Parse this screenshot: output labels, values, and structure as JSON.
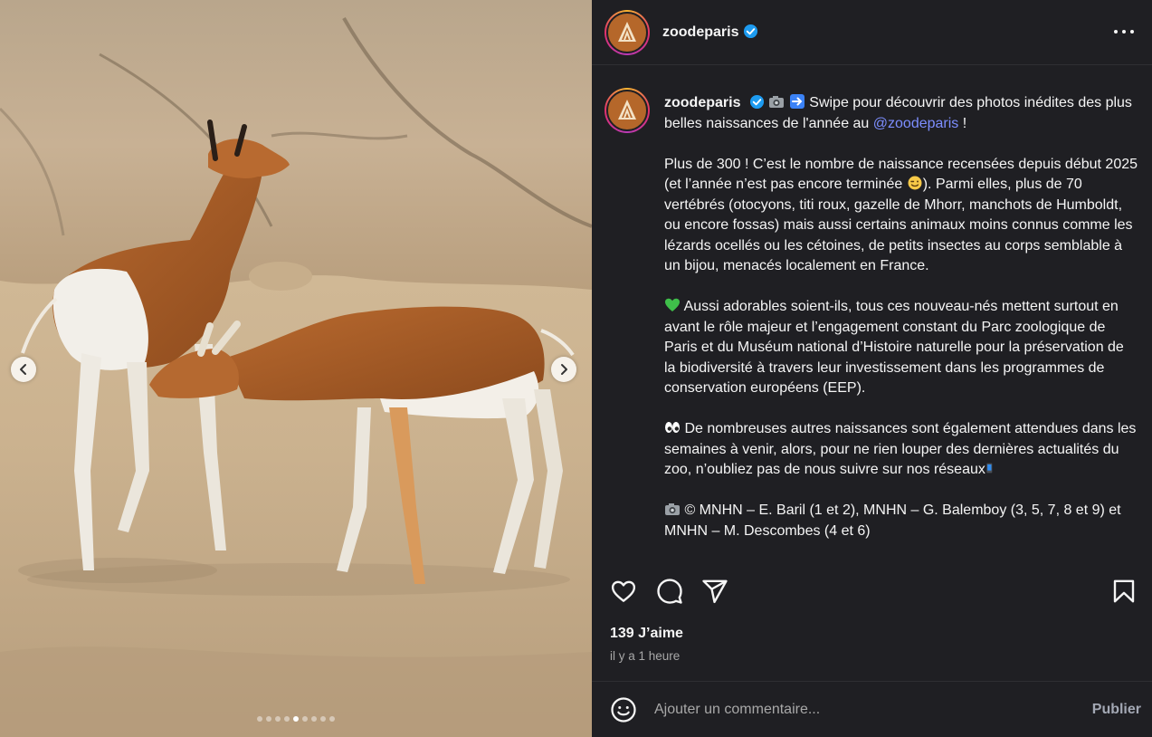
{
  "post": {
    "username": "zoodeparis",
    "verified": true,
    "more_icon": "more-horizontal-icon",
    "carousel": {
      "total_slides": 9,
      "current_slide": 5,
      "prev_icon": "chevron-left-icon",
      "next_icon": "chevron-right-icon"
    }
  },
  "caption": {
    "username": "zoodeparis",
    "line1": " Swipe pour découvrir des photos inédites des plus belles naissances de l'année au ",
    "mention": "@zoodeparis",
    "line1_end": " !",
    "p2a": "Plus de 300 ! C’est le nombre de naissance recensées depuis début 2025 (et l’année n’est pas encore terminée ",
    "p2b": "). Parmi elles, plus de 70 vertébrés (otocyons, titi roux, gazelle de Mhorr, manchots de Humboldt, ou encore fossas) mais aussi certains animaux moins connus comme les lézards ocellés ou les cétoines, de petits insectes au corps semblable à un bijou, menacés localement en France.",
    "p3": " Aussi adorables soient-ils, tous ces nouveau-nés mettent surtout en avant le rôle majeur et l’engagement constant du Parc zoologique de Paris et du Muséum national d’Histoire naturelle pour la préservation de la biodiversité à travers leur investissement dans les programmes de conservation européens (EEP).",
    "p4": " De nombreuses autres naissances sont également attendues dans les semaines à venir, alors, pour ne rien louper des dernières actualités du zoo, n’oubliez pas de nous suivre sur nos réseaux",
    "p5": " © MNHN – E. Baril (1 et 2), MNHN – G. Balemboy (3, 5, 7, 8 et 9) et MNHN – M. Descombes (4 et 6)"
  },
  "actions": {
    "like_icon": "heart-icon",
    "comment_icon": "comment-icon",
    "share_icon": "paper-plane-icon",
    "save_icon": "bookmark-icon"
  },
  "stats": {
    "likes": "139 J’aime",
    "time": "il y a 1 heure"
  },
  "comment": {
    "placeholder": "Ajouter un commentaire...",
    "publish_label": "Publier",
    "emoji_icon": "smiley-icon"
  },
  "colors": {
    "panel_bg": "#1f1f23",
    "mention": "#7d8eff",
    "verified": "#1d9bf0",
    "muted": "#a8a8a8"
  }
}
